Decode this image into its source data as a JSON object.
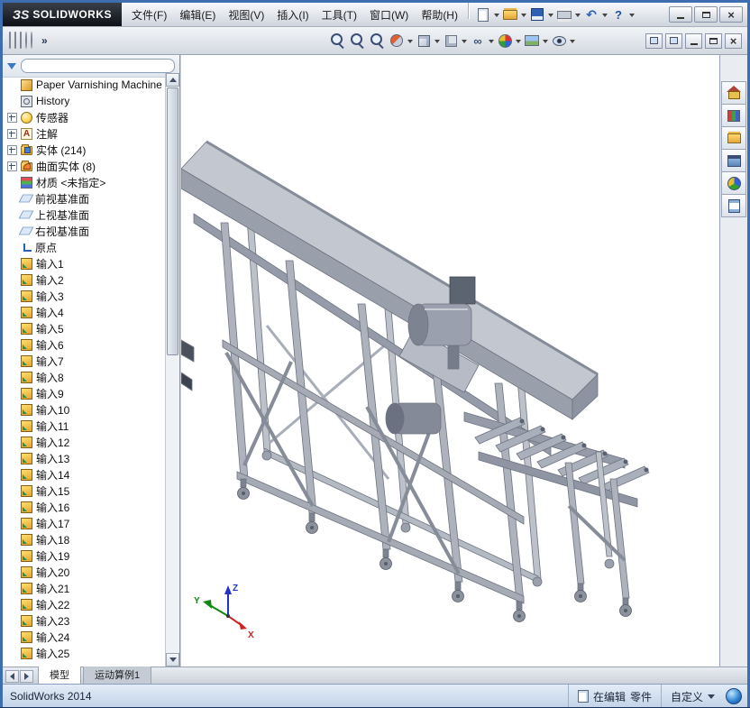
{
  "titlebar": {
    "logo_mark": "ЗS",
    "logo_text": "SOLIDWORKS",
    "menus": [
      "文件(F)",
      "编辑(E)",
      "视图(V)",
      "插入(I)",
      "工具(T)",
      "窗口(W)",
      "帮助(H)"
    ],
    "tool_icons": [
      {
        "name": "new-document",
        "dd": true
      },
      {
        "name": "open",
        "dd": true
      },
      {
        "name": "save",
        "dd": true
      },
      {
        "name": "print",
        "dd": true
      },
      {
        "name": "undo",
        "dd": true
      },
      {
        "name": "help",
        "dd": true
      }
    ]
  },
  "toolbar": {
    "addin_icons": [
      "addin-icon-1",
      "addin-icon-2",
      "addin-icon-3",
      "addin-icon-4",
      "addin-icon-5"
    ],
    "overflow": "»",
    "view_icons": [
      {
        "name": "zoom-in-out",
        "kind": "mag",
        "dd": false
      },
      {
        "name": "zoom-fit",
        "kind": "mag",
        "dd": false
      },
      {
        "name": "zoom-area",
        "kind": "mag",
        "dd": false
      },
      {
        "name": "section-view",
        "kind": "section-view",
        "dd": true
      },
      {
        "name": "view-orientation",
        "kind": "view-orientation",
        "dd": true
      },
      {
        "name": "display-style",
        "kind": "display-style",
        "dd": true
      },
      {
        "name": "hide-show-items",
        "kind": "hide-show-items",
        "dd": true
      },
      {
        "name": "edit-appearance",
        "kind": "edit-appearance",
        "dd": true
      },
      {
        "name": "apply-scene",
        "kind": "apply-scene",
        "dd": true
      },
      {
        "name": "view-settings",
        "kind": "view-settings",
        "dd": true
      }
    ]
  },
  "filter": {
    "placeholder": ""
  },
  "tree": {
    "root": "Paper Varnishing Machine",
    "items": [
      {
        "icon": "history",
        "label": "History",
        "exp": false
      },
      {
        "icon": "sensor",
        "label": "传感器",
        "exp": true
      },
      {
        "icon": "annotation",
        "label": "注解",
        "exp": true
      },
      {
        "icon": "solid-folder",
        "label": "实体 (214)",
        "exp": true
      },
      {
        "icon": "surface-folder",
        "label": "曲面实体 (8)",
        "exp": true
      },
      {
        "icon": "material",
        "label": "材质 <未指定>",
        "exp": false
      },
      {
        "icon": "plane",
        "label": "前视基准面",
        "exp": false
      },
      {
        "icon": "plane",
        "label": "上视基准面",
        "exp": false
      },
      {
        "icon": "plane",
        "label": "右视基准面",
        "exp": false
      },
      {
        "icon": "origin",
        "label": "原点",
        "exp": false
      },
      {
        "icon": "import",
        "label": "输入1",
        "exp": false
      },
      {
        "icon": "import",
        "label": "输入2",
        "exp": false
      },
      {
        "icon": "import",
        "label": "输入3",
        "exp": false
      },
      {
        "icon": "import",
        "label": "输入4",
        "exp": false
      },
      {
        "icon": "import",
        "label": "输入5",
        "exp": false
      },
      {
        "icon": "import",
        "label": "输入6",
        "exp": false
      },
      {
        "icon": "import",
        "label": "输入7",
        "exp": false
      },
      {
        "icon": "import",
        "label": "输入8",
        "exp": false
      },
      {
        "icon": "import",
        "label": "输入9",
        "exp": false
      },
      {
        "icon": "import",
        "label": "输入10",
        "exp": false
      },
      {
        "icon": "import",
        "label": "输入11",
        "exp": false
      },
      {
        "icon": "import",
        "label": "输入12",
        "exp": false
      },
      {
        "icon": "import",
        "label": "输入13",
        "exp": false
      },
      {
        "icon": "import",
        "label": "输入14",
        "exp": false
      },
      {
        "icon": "import",
        "label": "输入15",
        "exp": false
      },
      {
        "icon": "import",
        "label": "输入16",
        "exp": false
      },
      {
        "icon": "import",
        "label": "输入17",
        "exp": false
      },
      {
        "icon": "import",
        "label": "输入18",
        "exp": false
      },
      {
        "icon": "import",
        "label": "输入19",
        "exp": false
      },
      {
        "icon": "import",
        "label": "输入20",
        "exp": false
      },
      {
        "icon": "import",
        "label": "输入21",
        "exp": false
      },
      {
        "icon": "import",
        "label": "输入22",
        "exp": false
      },
      {
        "icon": "import",
        "label": "输入23",
        "exp": false
      },
      {
        "icon": "import",
        "label": "输入24",
        "exp": false
      },
      {
        "icon": "import",
        "label": "输入25",
        "exp": false
      }
    ]
  },
  "viewport": {
    "triad": {
      "x": "X",
      "y": "Y",
      "z": "Z"
    }
  },
  "taskpane": {
    "icons": [
      "solidworks-resources",
      "design-library",
      "file-explorer",
      "view-palette",
      "appearances-scenes",
      "custom-properties"
    ]
  },
  "tabs": {
    "items": [
      {
        "key": "model",
        "label": "模型",
        "active": true
      },
      {
        "key": "motion-study-1",
        "label": "运动算例1",
        "active": false
      }
    ]
  },
  "statusbar": {
    "app": "SolidWorks 2014",
    "editing": "在编辑",
    "doctype": "零件",
    "custom": "自定义"
  },
  "colors": {
    "window_border": "#3e6db0",
    "accent_gold": "#e2a83c",
    "model_gray": "#adb2bc"
  }
}
